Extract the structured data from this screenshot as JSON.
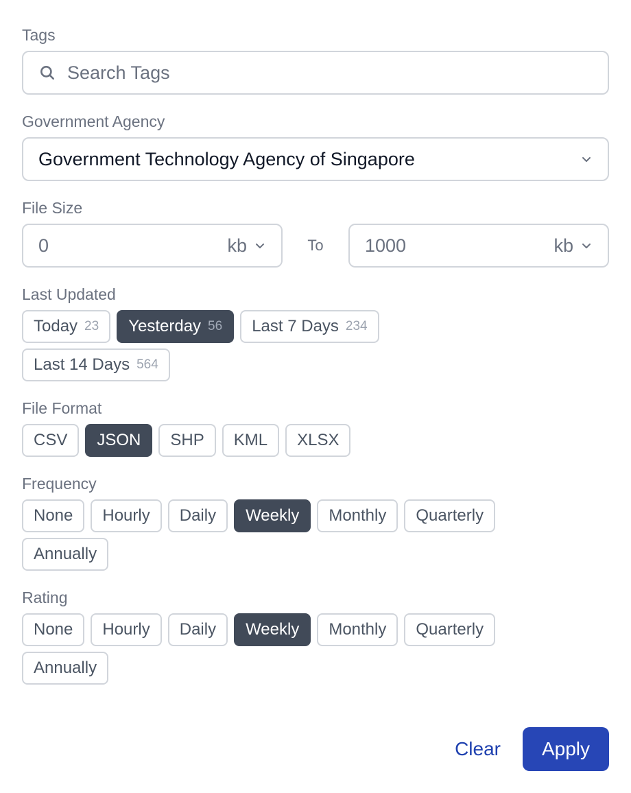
{
  "tags": {
    "label": "Tags",
    "placeholder": "Search Tags",
    "icon": "search-icon"
  },
  "agency": {
    "label": "Government Agency",
    "selected": "Government Technology Agency of Singapore",
    "icon": "chevron-down-icon"
  },
  "file_size": {
    "label": "File Size",
    "min_value": "0",
    "min_unit": "kb",
    "to_label": "To",
    "max_value": "1000",
    "max_unit": "kb"
  },
  "last_updated": {
    "label": "Last Updated",
    "options": [
      {
        "label": "Today",
        "count": "23",
        "active": false
      },
      {
        "label": "Yesterday",
        "count": "56",
        "active": true
      },
      {
        "label": "Last 7 Days",
        "count": "234",
        "active": false
      },
      {
        "label": "Last 14 Days",
        "count": "564",
        "active": false
      }
    ]
  },
  "file_format": {
    "label": "File Format",
    "options": [
      {
        "label": "CSV",
        "active": false
      },
      {
        "label": "JSON",
        "active": true
      },
      {
        "label": "SHP",
        "active": false
      },
      {
        "label": "KML",
        "active": false
      },
      {
        "label": "XLSX",
        "active": false
      }
    ]
  },
  "frequency": {
    "label": "Frequency",
    "options": [
      {
        "label": "None",
        "active": false
      },
      {
        "label": "Hourly",
        "active": false
      },
      {
        "label": "Daily",
        "active": false
      },
      {
        "label": "Weekly",
        "active": true
      },
      {
        "label": "Monthly",
        "active": false
      },
      {
        "label": "Quarterly",
        "active": false
      },
      {
        "label": "Annually",
        "active": false
      }
    ]
  },
  "rating": {
    "label": "Rating",
    "options": [
      {
        "label": "None",
        "active": false
      },
      {
        "label": "Hourly",
        "active": false
      },
      {
        "label": "Daily",
        "active": false
      },
      {
        "label": "Weekly",
        "active": true
      },
      {
        "label": "Monthly",
        "active": false
      },
      {
        "label": "Quarterly",
        "active": false
      },
      {
        "label": "Annually",
        "active": false
      }
    ]
  },
  "footer": {
    "clear_label": "Clear",
    "apply_label": "Apply"
  },
  "colors": {
    "active_chip": "#414a58",
    "primary": "#2746b6",
    "link": "#1e40af",
    "border": "#d1d5db"
  }
}
